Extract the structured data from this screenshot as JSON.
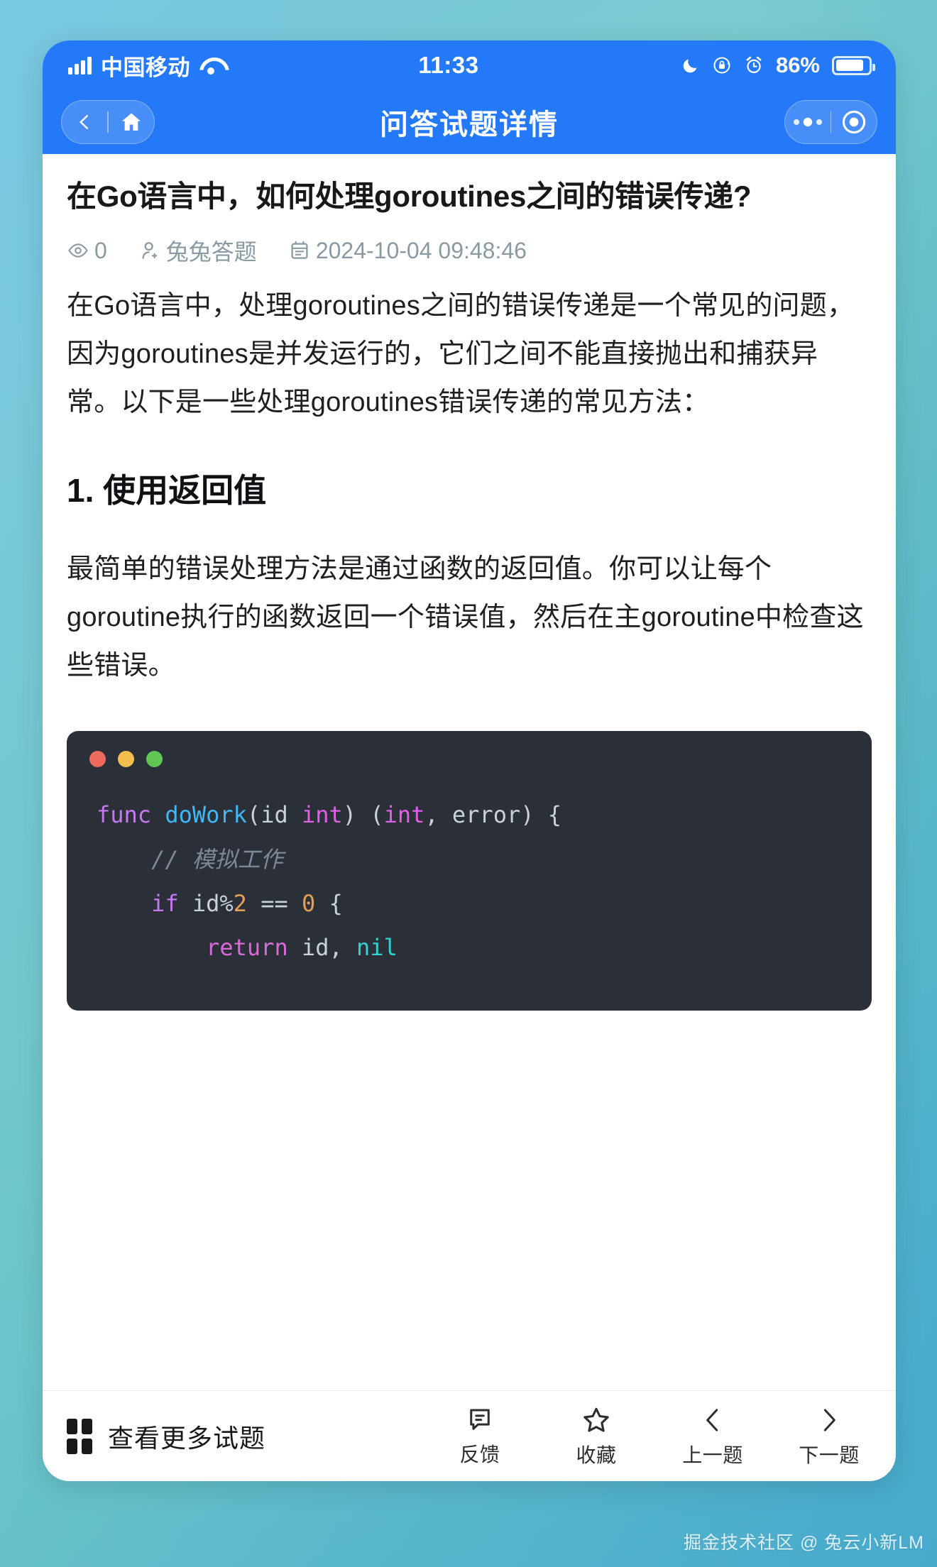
{
  "status_bar": {
    "carrier": "中国移动",
    "time": "11:33",
    "battery_percent": "86%",
    "icons": [
      "signal-icon",
      "wifi-icon",
      "moon-icon",
      "rotation-lock-icon",
      "alarm-icon",
      "battery-icon"
    ]
  },
  "nav": {
    "title": "问答试题详情",
    "back_icon": "chevron-left-icon",
    "home_icon": "home-icon",
    "menu_icon": "more-dots-icon",
    "close_icon": "target-circle-icon"
  },
  "question": {
    "title": "在Go语言中，如何处理goroutines之间的错误传递?",
    "views": "0",
    "author": "兔兔答题",
    "date": "2024-10-04 09:48:46",
    "views_icon": "eye-icon",
    "author_icon": "user-icon",
    "date_icon": "calendar-icon"
  },
  "article": {
    "intro": "在Go语言中，处理goroutines之间的错误传递是一个常见的问题，因为goroutines是并发运行的，它们之间不能直接抛出和捕获异常。以下是一些处理goroutines错误传递的常见方法：",
    "heading_1": "1. 使用返回值",
    "paragraph_1": "最简单的错误处理方法是通过函数的返回值。你可以让每个goroutine执行的函数返回一个错误值，然后在主goroutine中检查这些错误。"
  },
  "code_block": {
    "language": "go",
    "window_dots": [
      "#ed6a5e",
      "#f4bf4f",
      "#61c554"
    ],
    "lines": [
      {
        "tokens": [
          {
            "t": "func ",
            "c": "kw"
          },
          {
            "t": "doWork",
            "c": "fn"
          },
          {
            "t": "(id ",
            "c": "pl"
          },
          {
            "t": "int",
            "c": "type"
          },
          {
            "t": ") (",
            "c": "pl"
          },
          {
            "t": "int",
            "c": "type"
          },
          {
            "t": ", error) {",
            "c": "pl"
          }
        ]
      },
      {
        "tokens": [
          {
            "t": "    // 模拟工作",
            "c": "cm"
          }
        ]
      },
      {
        "tokens": [
          {
            "t": "    ",
            "c": "pl"
          },
          {
            "t": "if",
            "c": "kw"
          },
          {
            "t": " id%",
            "c": "pl"
          },
          {
            "t": "2",
            "c": "num"
          },
          {
            "t": " == ",
            "c": "pl"
          },
          {
            "t": "0",
            "c": "num"
          },
          {
            "t": " {",
            "c": "pl"
          }
        ]
      },
      {
        "tokens": [
          {
            "t": "        ",
            "c": "pl"
          },
          {
            "t": "return",
            "c": "ret"
          },
          {
            "t": " id, ",
            "c": "pl"
          },
          {
            "t": "nil",
            "c": "const"
          }
        ]
      }
    ]
  },
  "toolbar": {
    "more_label": "查看更多试题",
    "more_icon": "grid-icon",
    "actions": [
      {
        "label": "反馈",
        "icon": "feedback-icon"
      },
      {
        "label": "收藏",
        "icon": "star-icon"
      },
      {
        "label": "上一题",
        "icon": "chevron-left-icon"
      },
      {
        "label": "下一题",
        "icon": "chevron-right-icon"
      }
    ]
  },
  "watermark": "掘金技术社区 @ 兔云小新LM",
  "colors": {
    "brand_blue": "#2479f8",
    "code_bg": "#2b2f38",
    "meta_gray": "#8a9aa3"
  }
}
